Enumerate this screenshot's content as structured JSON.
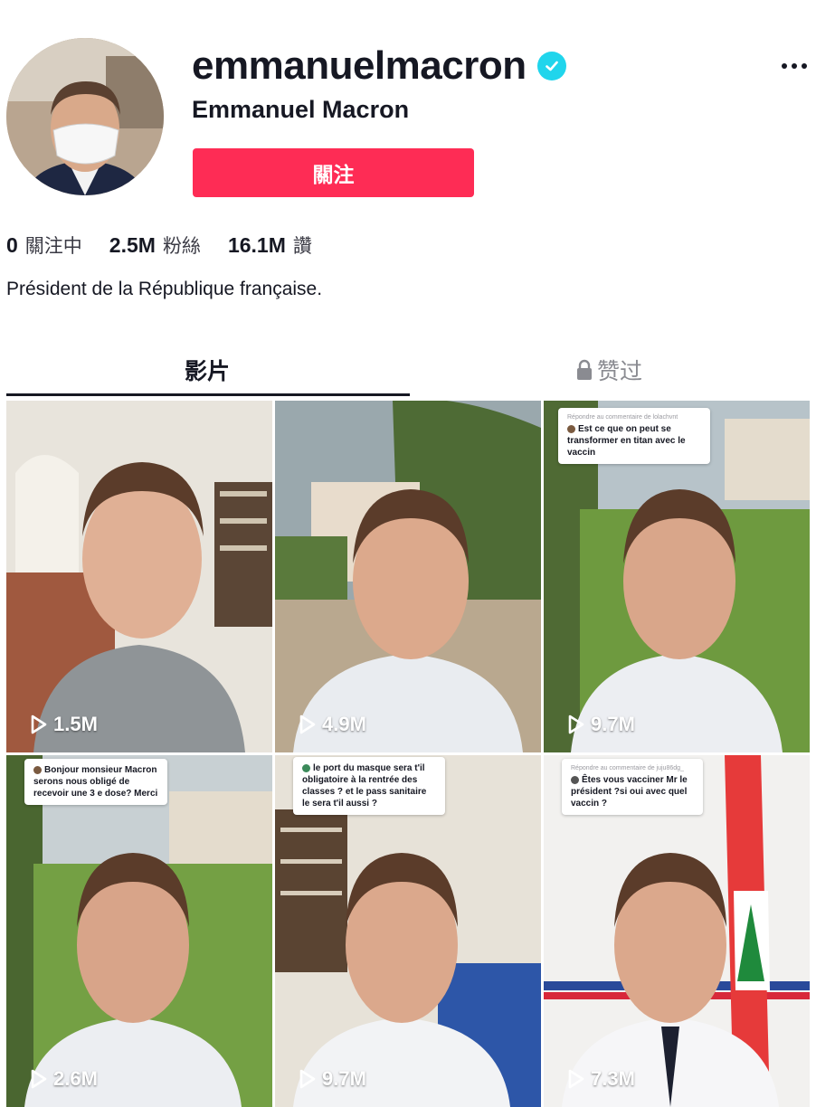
{
  "profile": {
    "username": "emmanuelmacron",
    "display_name": "Emmanuel Macron",
    "verified": true,
    "follow_label": "關注",
    "bio": "Président de la République française."
  },
  "stats": [
    {
      "value": "0",
      "label": "關注中"
    },
    {
      "value": "2.5M",
      "label": "粉絲"
    },
    {
      "value": "16.1M",
      "label": "讚"
    }
  ],
  "tabs": {
    "videos": "影片",
    "liked": "赞过"
  },
  "videos": [
    {
      "views": "1.5M"
    },
    {
      "views": "4.9M"
    },
    {
      "views": "9.7M",
      "reply": "Répondre au commentaire de lolachvnt",
      "question": "Est ce que on peut se transformer en titan avec le vaccin"
    },
    {
      "views": "2.6M",
      "question": "Bonjour monsieur Macron serons nous obligé de recevoir une 3 e dose? Merci"
    },
    {
      "views": "9.7M",
      "question": "le port du masque sera t'il obligatoire à la rentrée des classes ? et le pass sanitaire le sera t'il aussi ?"
    },
    {
      "views": "7.3M",
      "reply": "Répondre au commentaire de juju86dg_",
      "question": "Êtes vous vacciner Mr le président ?si oui avec quel vaccin ?"
    }
  ],
  "colors": {
    "accent": "#fe2c55",
    "verified": "#20d5ec",
    "text": "#161823",
    "muted": "#8a8b91"
  },
  "icons": [
    "verified-badge-icon",
    "more-options-icon",
    "lock-icon",
    "play-icon"
  ]
}
